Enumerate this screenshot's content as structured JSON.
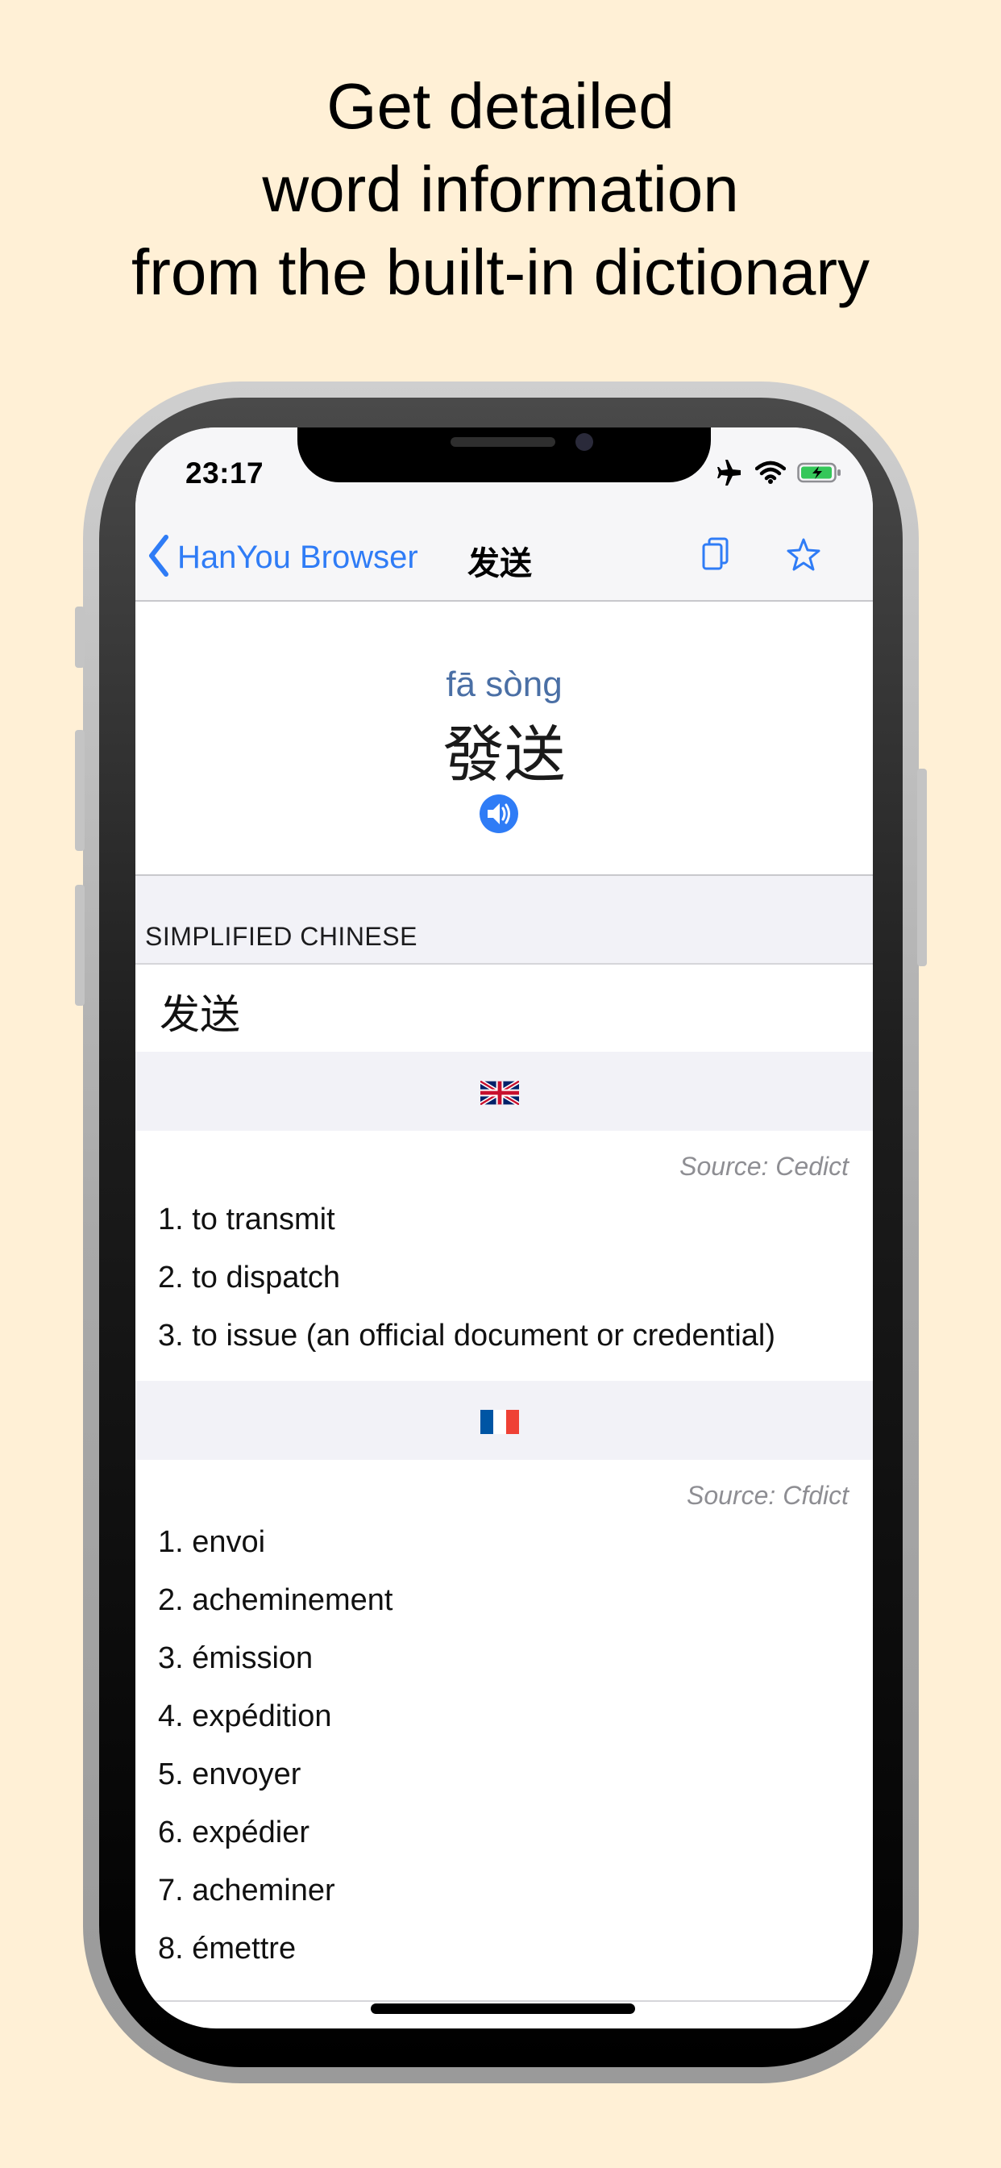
{
  "headline": {
    "line1": "Get detailed",
    "line2": "word information",
    "line3": "from the built-in dictionary"
  },
  "status_bar": {
    "time": "23:17",
    "icons": [
      "airplane-icon",
      "wifi-icon",
      "battery-charging-icon"
    ]
  },
  "nav": {
    "back_label": "HanYou Browser",
    "title": "发送",
    "icons": [
      "copy-icon",
      "star-icon"
    ]
  },
  "word": {
    "pinyin": "fā sòng",
    "traditional": "發送",
    "audio_icon": "speaker-icon"
  },
  "simplified": {
    "header": "SIMPLIFIED CHINESE",
    "value": "发送"
  },
  "english": {
    "flag_icon": "uk-flag-icon",
    "source": "Source: Cedict",
    "definitions": [
      "1. to transmit",
      "2. to dispatch",
      "3. to issue (an official document or credential)"
    ]
  },
  "french": {
    "flag_icon": "france-flag-icon",
    "source": "Source: Cfdict",
    "definitions": [
      "1. envoi",
      "2. acheminement",
      "3. émission",
      "4. expédition",
      "5. envoyer",
      "6. expédier",
      "7. acheminer",
      "8. émettre"
    ]
  },
  "colors": {
    "background": "#fff0d6",
    "accent": "#2f7cf6",
    "pinyin": "#4a6fa5",
    "section_bg": "#f2f2f7",
    "source_text": "#8e8e93"
  }
}
